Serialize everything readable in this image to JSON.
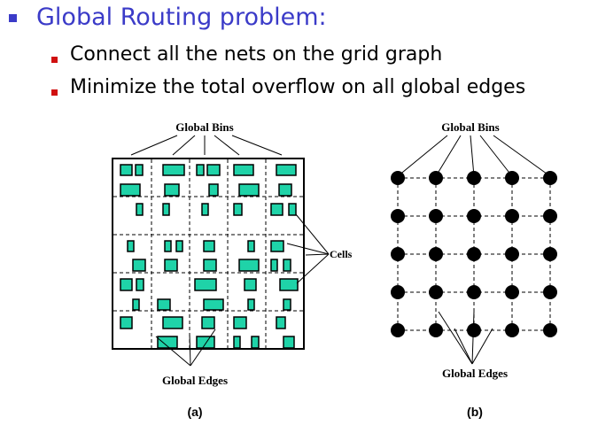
{
  "slide": {
    "title": "Global Routing problem:",
    "bullets": [
      "Connect all the nets on the grid graph",
      "Minimize the total overflow on all global edges"
    ]
  },
  "figure_a": {
    "top_label": "Global Bins",
    "cells_label": "Cells",
    "bottom_label": "Global Edges",
    "caption": "(a)",
    "cell_color": "#1fd3a8"
  },
  "figure_b": {
    "top_label": "Global Bins",
    "bottom_label": "Global Edges",
    "caption": "(b)",
    "grid_rows": 5,
    "grid_cols": 5
  },
  "colors": {
    "title": "#3b3bc8",
    "sub_bullet": "#d01010"
  }
}
